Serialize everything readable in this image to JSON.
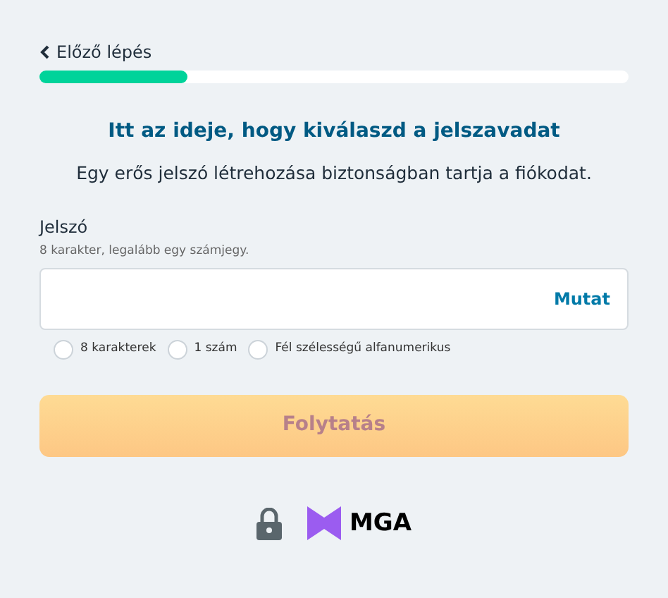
{
  "back_link": {
    "label": "Előző lépés"
  },
  "progress": {
    "level": 0.25
  },
  "heading": "Itt az ideje, hogy kiválaszd a jelszavadat",
  "subtitle": "Egy erős jelszó létrehozása biztonságban tartja a fiókodat.",
  "password_field": {
    "label": "Jelszó",
    "hint": "8 karakter, legalább egy számjegy.",
    "toggle": "Mutat"
  },
  "requirements": [
    {
      "label": "8 karakterek",
      "checked": false
    },
    {
      "label": "1 szám",
      "checked": false
    },
    {
      "label": "Fél szélességű alfanumerikus",
      "checked": false
    }
  ],
  "continue_button": {
    "label": "Folytatás",
    "disabled": true
  },
  "footer": {
    "logo_text": "MGA"
  }
}
